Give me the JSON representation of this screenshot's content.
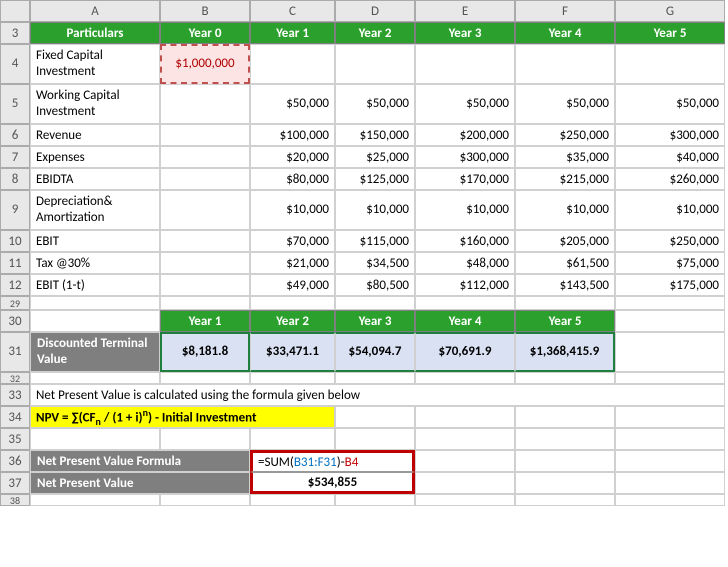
{
  "cols": [
    "A",
    "B",
    "C",
    "D",
    "E",
    "F",
    "G"
  ],
  "rows1": [
    "3",
    "4",
    "5",
    "6",
    "7",
    "8",
    "9",
    "10",
    "11",
    "12",
    "29"
  ],
  "rows2": [
    "30",
    "31",
    "32",
    "33",
    "34",
    "35",
    "36",
    "37",
    "38"
  ],
  "hdr": {
    "particulars": "Particulars",
    "y0": "Year 0",
    "y1": "Year 1",
    "y2": "Year 2",
    "y3": "Year 3",
    "y4": "Year 4",
    "y5": "Year 5"
  },
  "r4": {
    "label": "Fixed Capital Investment",
    "b": "$1,000,000"
  },
  "r5": {
    "label": "Working Capital Investment",
    "c": "$50,000",
    "d": "$50,000",
    "e": "$50,000",
    "f": "$50,000",
    "g": "$50,000"
  },
  "r6": {
    "label": "Revenue",
    "c": "$100,000",
    "d": "$150,000",
    "e": "$200,000",
    "f": "$250,000",
    "g": "$300,000"
  },
  "r7": {
    "label": "Expenses",
    "c": "$20,000",
    "d": "$25,000",
    "e": "$300,000",
    "f": "$35,000",
    "g": "$40,000"
  },
  "r8": {
    "label": "EBIDTA",
    "c": "$80,000",
    "d": "$125,000",
    "e": "$170,000",
    "f": "$215,000",
    "g": "$260,000"
  },
  "r9": {
    "label": "Depreciation& Amortization",
    "c": "$10,000",
    "d": "$10,000",
    "e": "$10,000",
    "f": "$10,000",
    "g": "$10,000"
  },
  "r10": {
    "label": "EBIT",
    "c": "$70,000",
    "d": "$115,000",
    "e": "$160,000",
    "f": "$205,000",
    "g": "$250,000"
  },
  "r11": {
    "label": "Tax @30%",
    "c": "$21,000",
    "d": "$34,500",
    "e": "$48,000",
    "f": "$61,500",
    "g": "$75,000"
  },
  "r12": {
    "label": "EBIT (1-t)",
    "c": "$49,000",
    "d": "$80,500",
    "e": "$112,000",
    "f": "$143,500",
    "g": "$175,000"
  },
  "r31": {
    "label": "Discounted Terminal Value",
    "b": "$8,181.8",
    "c": "$33,471.1",
    "d": "$54,094.7",
    "e": "$70,691.9",
    "f": "$1,368,415.9"
  },
  "r33": {
    "text": "Net Present Value is calculated using the formula given below"
  },
  "r34": {
    "npv_prefix": "NPV = ∑(CF",
    "npv_sub": "n",
    "npv_mid": " / (1 + i)",
    "npv_sup": "n",
    "npv_suffix": ") - Initial Investment"
  },
  "r36": {
    "label": "Net Present Value Formula",
    "eq": "=",
    "fn": "SUM(",
    "range": "B31:F31",
    "close": ")-",
    "ref": "B4"
  },
  "r37": {
    "label": "Net Present Value",
    "val": "$534,855"
  }
}
